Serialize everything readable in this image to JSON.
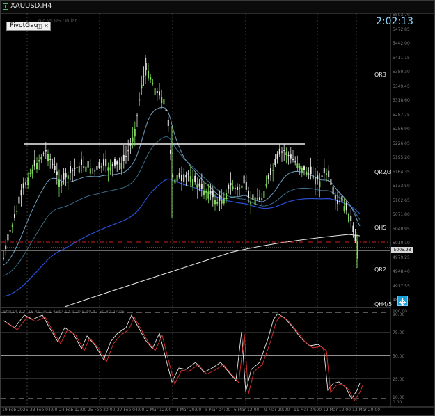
{
  "window": {
    "title": "XAUUSD,H4"
  },
  "indicator_box": {
    "label": "PivotGau",
    "icons": [
      "◫",
      "✕"
    ]
  },
  "chart_subtitle": "old vs US Dollar",
  "clock": "2:02:13",
  "price_axis": [
    "5503.70",
    "5472.85",
    "5442.00",
    "5411.15",
    "5380.30",
    "5349.45",
    "5318.60",
    "5287.75",
    "5256.90",
    "5226.05",
    "5195.20",
    "5164.35",
    "5133.50",
    "5102.65",
    "5071.80",
    "5040.95",
    "5010.10",
    "4979.25",
    "4948.40",
    "4917.55",
    "4886.70"
  ],
  "current_price_box": "5005.98",
  "pivot_levels": [
    {
      "name": "QR3"
    },
    {
      "name": "QR2/3"
    },
    {
      "name": "QH5"
    },
    {
      "name": "QR2"
    },
    {
      "name": "QH4/5"
    }
  ],
  "oscillator_axis": [
    "100.00",
    "90.00",
    "75.00",
    "50.00",
    "25.00",
    "10.00",
    "0.00"
  ],
  "oscillator_header": "Sto(14,3,3) 16.41 Gr. 1.4647 10.2 20.5 40.47 60.80 27 06",
  "date_axis": [
    "19 Feb 2026",
    "23 Feb 04:00",
    "24 Feb 12:00",
    "25 Feb 20:00",
    "27 Feb 04:00",
    "2 Mar 12:00",
    "3 Mar 20:00",
    "5 Mar 04:00",
    "6 Mar 12:00",
    "9 Mar 20:00",
    "11 Mar 04:00",
    "12 Mar 12:00",
    "13 Mar 20:00"
  ],
  "colors": {
    "bull_candle": "#7ed957",
    "bear_candle": "#e8e8e8",
    "ma_fast": "#2a4fd6",
    "ma_mid": "#3a6f8a",
    "ma_slow": "#6fa0c0",
    "ma_long": "#e8e8e8",
    "stoch_main": "#e8e8e8",
    "stoch_signal": "#e03030",
    "pivot_line": "#d02020",
    "clock": "#8fd7ff"
  }
}
